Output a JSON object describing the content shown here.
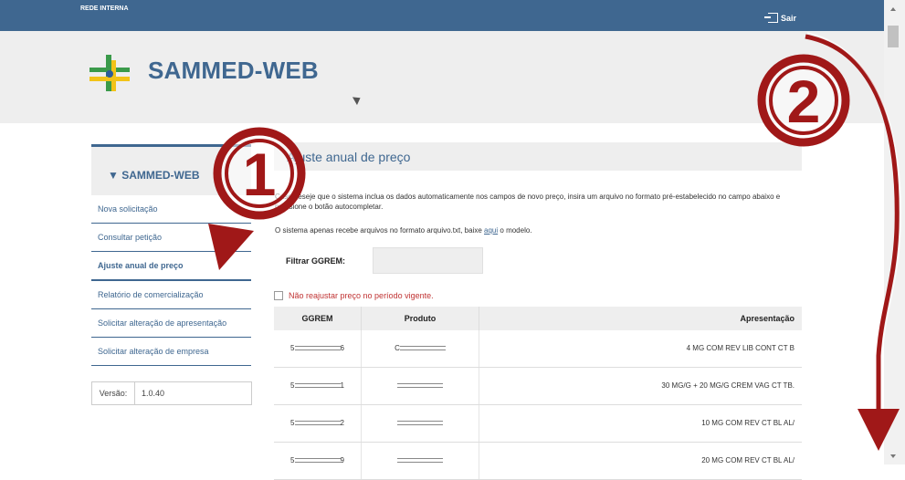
{
  "topbar": {
    "network_label": "REDE INTERNA",
    "exit_label": "Sair"
  },
  "header": {
    "brand": "SAMMED-WEB"
  },
  "sidebar": {
    "title": "SAMMED-WEB",
    "items": [
      {
        "label": "Nova solicitação"
      },
      {
        "label": "Consultar petição"
      },
      {
        "label": "Ajuste anual de preço"
      },
      {
        "label": "Relatório de comercialização"
      },
      {
        "label": "Solicitar alteração de apresentação"
      },
      {
        "label": "Solicitar alteração de empresa"
      }
    ],
    "version_label": "Versão:",
    "version_value": "1.0.40"
  },
  "main": {
    "title": "Ajuste anual de preço",
    "instructions": "Caso deseje que o sistema inclua os dados automaticamente nos campos de novo preço, insira um arquivo no formato pré-estabelecido no campo abaixo e pressione o botão autocompletar.",
    "info_prefix": "O sistema apenas recebe arquivos no formato arquivo.txt, baixe",
    "info_link": "aqui",
    "info_suffix": "o modelo.",
    "filter_label": "Filtrar GGREM:",
    "checkbox_label": "Não reajustar preço no período vigente."
  },
  "table": {
    "headers": [
      "GGREM",
      "Produto",
      "Apresentação"
    ],
    "rows": [
      {
        "ggrem_prefix": "5",
        "ggrem_suffix": "6",
        "produto_prefix": "C",
        "apresentacao": "4 MG COM REV LIB CONT CT B"
      },
      {
        "ggrem_prefix": "5",
        "ggrem_suffix": "1",
        "produto_prefix": "",
        "apresentacao": "30 MG/G + 20 MG/G CREM VAG CT TB."
      },
      {
        "ggrem_prefix": "5",
        "ggrem_suffix": "2",
        "produto_prefix": "",
        "apresentacao": "10 MG COM REV CT BL AL/"
      },
      {
        "ggrem_prefix": "5",
        "ggrem_suffix": "9",
        "produto_prefix": "",
        "apresentacao": "20 MG COM REV CT BL AL/"
      }
    ]
  },
  "annotations": {
    "marker_1": "1",
    "marker_2": "2"
  },
  "colors": {
    "brand_blue": "#3f6790",
    "annotation_red": "#a01818",
    "header_gray": "#eeeeee"
  },
  "icons": [
    "exit-icon",
    "logo-icon",
    "cursor-icon",
    "checkbox-icon",
    "scroll-up-icon",
    "scroll-down-icon"
  ]
}
